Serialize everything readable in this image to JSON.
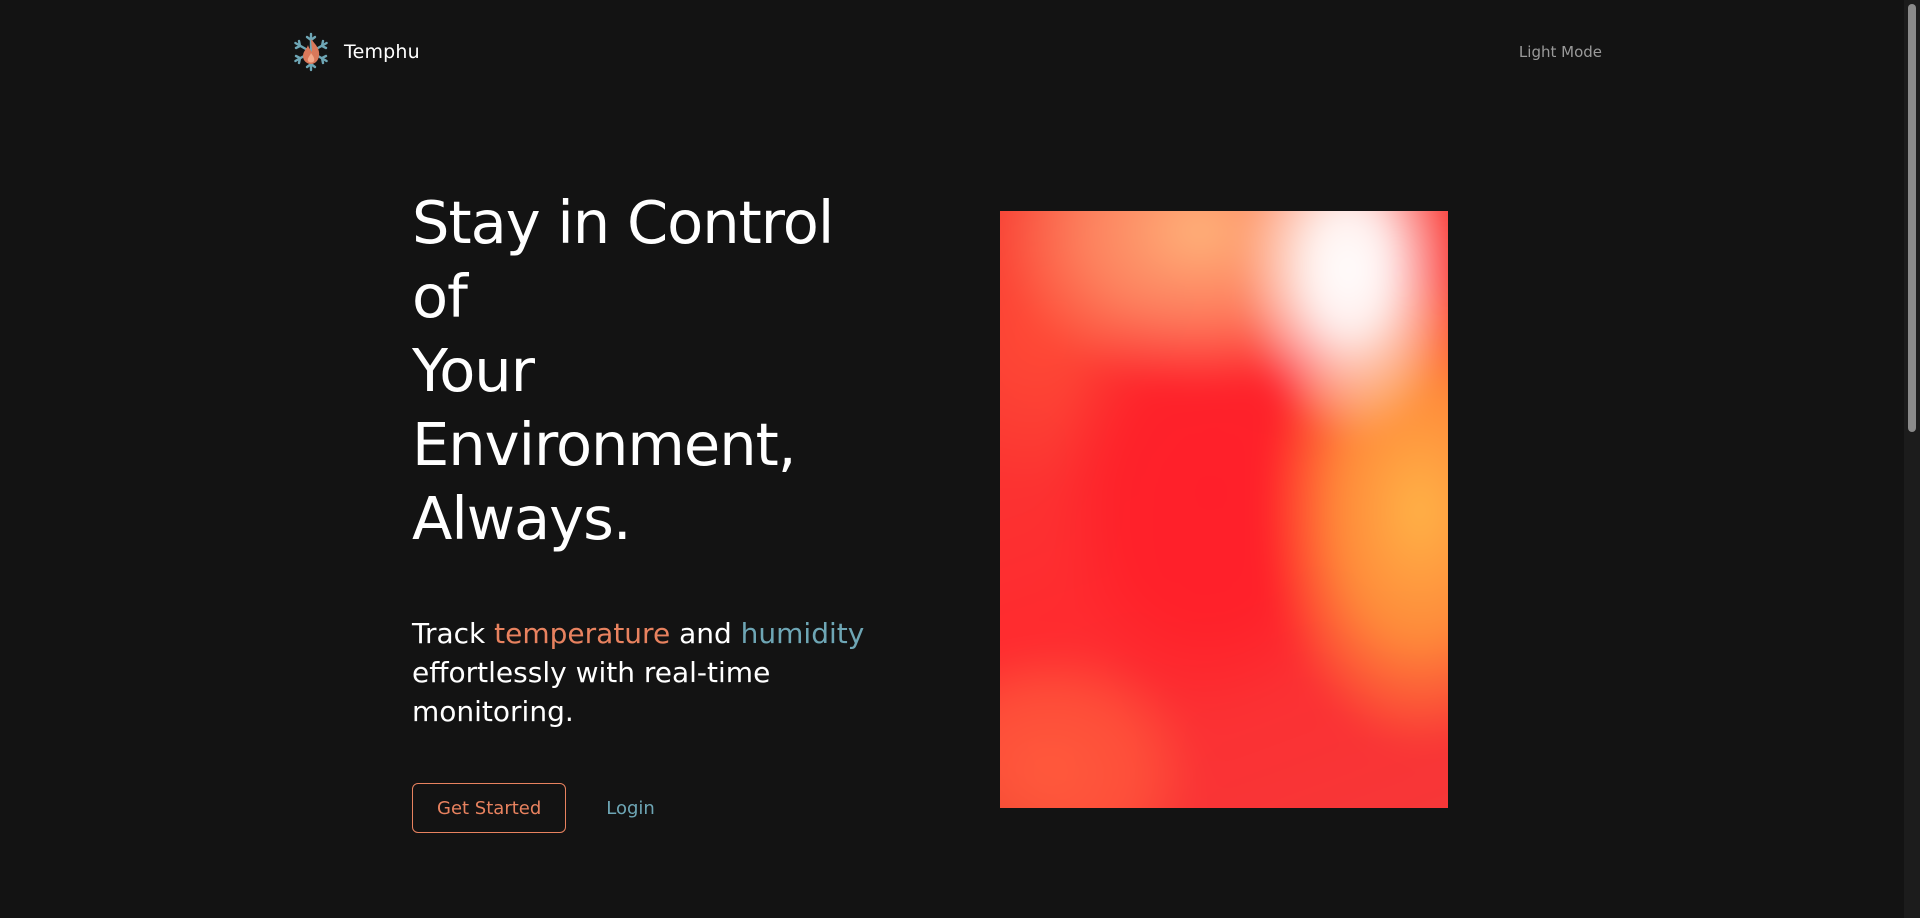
{
  "header": {
    "brand_name": "Temphu",
    "logo_icon": "snowflake-flame-icon",
    "mode_toggle_label": "Light Mode"
  },
  "hero": {
    "title_lines": [
      "Stay in Control",
      "of",
      "Your",
      "Environment,",
      "Always."
    ],
    "subtitle": {
      "prefix": "Track ",
      "temperature": "temperature",
      "middle": " and ",
      "humidity": "humidity",
      "suffix": " effortlessly with real-time monitoring."
    },
    "primary_button_label": "Get Started",
    "login_label": "Login"
  },
  "colors": {
    "background": "#131313",
    "accent_temperature": "#e8825f",
    "accent_humidity": "#6ea6b5",
    "muted_text": "#9a9a9a"
  }
}
